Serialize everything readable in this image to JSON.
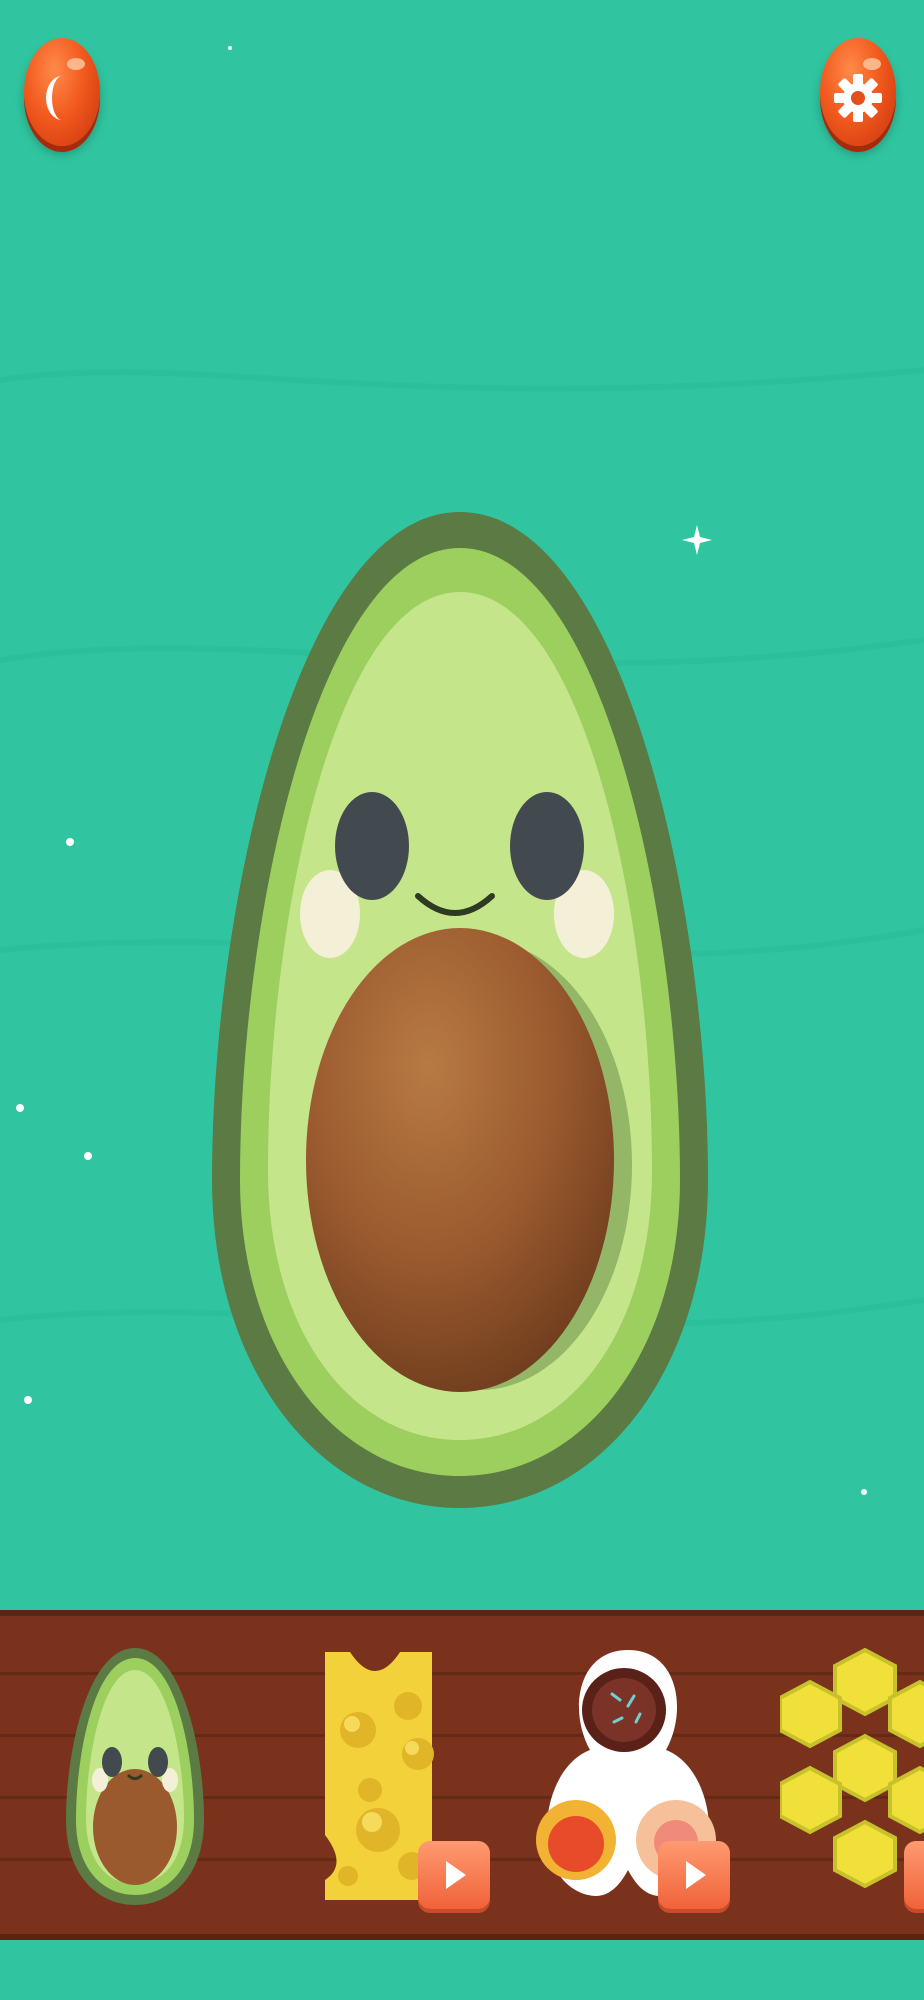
{
  "app": {
    "screen": "avocado-squishy-toy"
  },
  "colors": {
    "background": "#30c5a0",
    "tray": "#7a321d",
    "button": "#f25a1e",
    "avocado_outer": "#5b7a44",
    "avocado_flesh": "#9ccf5e",
    "avocado_inner": "#c5e58a",
    "pit": "#9a5a2e"
  },
  "top_bar": {
    "left_button_icon": "theme-toggle-icon",
    "right_button_icon": "gear-icon"
  },
  "main_toy": {
    "name": "avocado",
    "face": "smiling"
  },
  "toy_tray": {
    "items": [
      {
        "id": "avocado",
        "icon": "avocado-icon",
        "locked_video": false
      },
      {
        "id": "cheese",
        "icon": "cheese-icon",
        "locked_video": true
      },
      {
        "id": "spinner",
        "icon": "fidget-spinner-icon",
        "locked_video": true
      },
      {
        "id": "honeycomb",
        "icon": "honeycomb-icon",
        "locked_video": true
      }
    ]
  }
}
